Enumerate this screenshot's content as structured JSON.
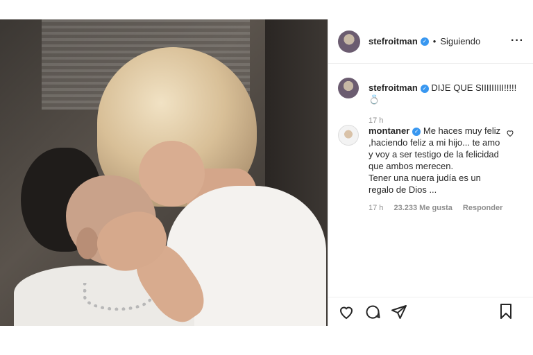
{
  "post": {
    "photo_alt": "",
    "header": {
      "username": "stefroitman",
      "follow_state": "Siguiendo",
      "separator": "•"
    },
    "caption": {
      "username": "stefroitman",
      "text": "DIJE QUE SIIIIIIIII!!!!! 💍",
      "time": "17 h"
    },
    "comment": {
      "username": "montaner",
      "lines": [
        "Me haces muy feliz",
        ",haciendo feliz a mi hijo... te amo",
        "y voy a ser testigo de la felicidad",
        "que ambos merecen.",
        "Tener una nuera judía es un",
        "regalo de Dios ..."
      ],
      "time": "17 h",
      "likes": "23.233 Me gusta",
      "reply": "Responder"
    },
    "icons": {
      "more": "more-options-icon",
      "verified": "verified-badge-icon",
      "like": "heart-icon",
      "comment": "comment-icon",
      "share": "share-icon",
      "save": "bookmark-icon"
    },
    "colors": {
      "verified": "#3897f0",
      "meta": "#8e8e8e",
      "text": "#262626"
    }
  }
}
